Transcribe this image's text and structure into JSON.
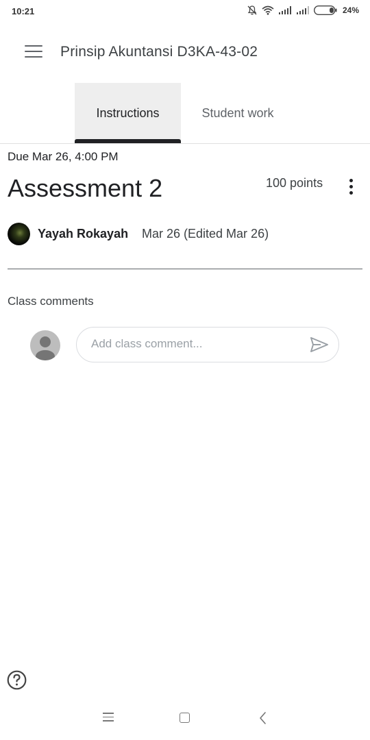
{
  "status_bar": {
    "time": "10:21",
    "battery": "24%",
    "icons": [
      "bell-off-icon",
      "wifi-icon",
      "signal-icon",
      "signal-icon",
      "battery-icon"
    ]
  },
  "app_bar": {
    "title": "Prinsip Akuntansi D3KA-43-02",
    "menu_icon": "hamburger-menu-icon"
  },
  "tabs": [
    {
      "label": "Instructions",
      "selected": true
    },
    {
      "label": "Student work",
      "selected": false
    }
  ],
  "assignment": {
    "due": "Due Mar 26, 4:00 PM",
    "title": "Assessment 2",
    "points": "100 points",
    "author": "Yayah Rokayah",
    "date": "Mar 26 (Edited Mar 26)"
  },
  "comments": {
    "heading": "Class comments",
    "placeholder": "Add class comment..."
  },
  "colors": {
    "tab_indicator": "#202124",
    "selected_tab_bg": "#eeeeee",
    "text_primary": "#202124",
    "text_secondary": "#5f6368"
  }
}
